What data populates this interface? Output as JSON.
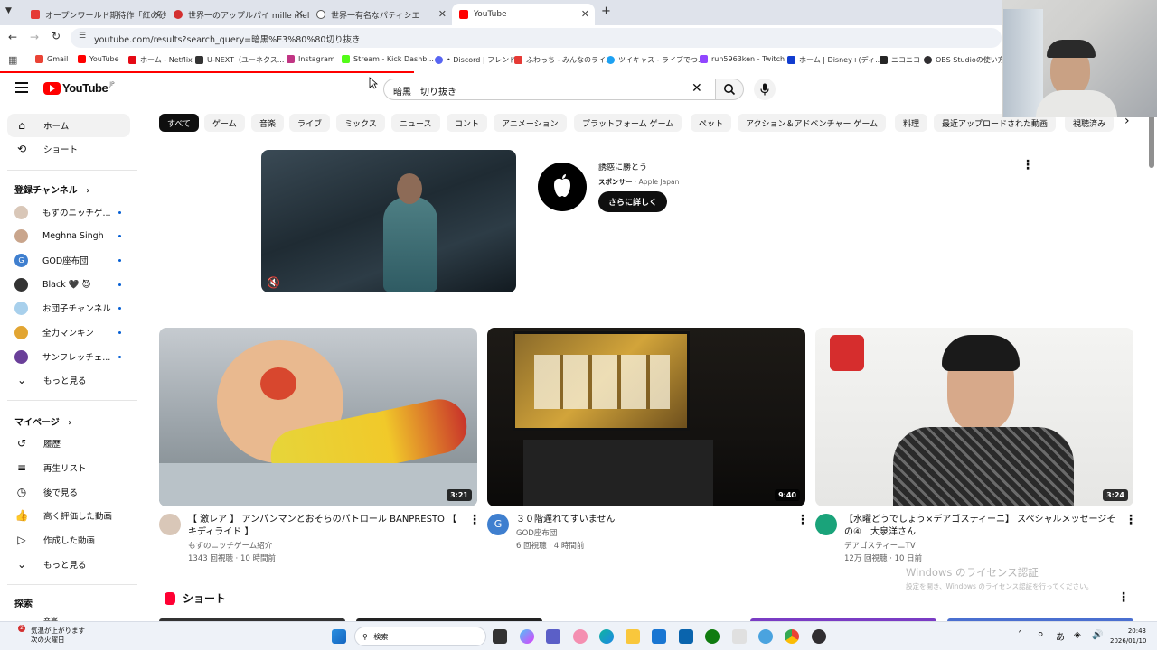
{
  "browser": {
    "tabs": [
      {
        "title": "オープンワールド期待作「紅の砂漠」",
        "color": "#e53935"
      },
      {
        "title": "世界一のアップルパイ mille mele",
        "color": "#d32f2f"
      },
      {
        "title": "世界一有名なパティシエ",
        "color": "#555555"
      },
      {
        "title": "YouTube",
        "color": "#ff0000"
      }
    ],
    "new_tab": "+",
    "url": "youtube.com/results?search_query=暗黒%E3%80%80切り抜き",
    "bookmarks": [
      {
        "label": "Gmail",
        "color": "#ea4335"
      },
      {
        "label": "YouTube",
        "color": "#ff0000"
      },
      {
        "label": "ホーム - Netflix",
        "color": "#e50914"
      },
      {
        "label": "U-NEXT（ユーネクス...",
        "color": "#333333"
      },
      {
        "label": "Instagram",
        "color": "#c13584"
      },
      {
        "label": "Stream - Kick Dashb...",
        "color": "#53fc18"
      },
      {
        "label": "• Discord | フレンド",
        "color": "#5865f2"
      },
      {
        "label": "ふわっち - みんなのライ...",
        "color": "#e53935"
      },
      {
        "label": "ツイキャス - ライブでつ...",
        "color": "#1da1f2"
      },
      {
        "label": "run5963ken - Twitch",
        "color": "#9146ff"
      },
      {
        "label": "ホーム | Disney+(ディ...",
        "color": "#113ccf"
      },
      {
        "label": "ニコニコ",
        "color": "#252525"
      },
      {
        "label": "OBS Studioの使い方...",
        "color": "#302e31"
      }
    ]
  },
  "youtube": {
    "logo": "YouTube",
    "region": "JP",
    "search_value": "暗黒　切り抜き",
    "sidebar": {
      "main": [
        {
          "label": "ホーム",
          "icon": "home-icon"
        },
        {
          "label": "ショート",
          "icon": "shorts-icon"
        }
      ],
      "subscriptions_title": "登録チャンネル",
      "subscriptions": [
        {
          "label": "もずのニッチゲ...",
          "color": "#d9c7b8"
        },
        {
          "label": "Meghna Singh",
          "color": "#c9a58c"
        },
        {
          "label": "GOD座布団",
          "color": "#3f7fcf",
          "letter": "G"
        },
        {
          "label": "Black 🖤 😈",
          "color": "#333333"
        },
        {
          "label": "お団子チャンネル",
          "color": "#a8d0ec"
        },
        {
          "label": "全力マンキン",
          "color": "#e2a532"
        },
        {
          "label": "サンフレッチェ...",
          "color": "#6a3f99"
        }
      ],
      "more_subs": "もっと見る",
      "you_title": "マイページ",
      "you_items": [
        {
          "label": "履歴",
          "icon": "history-icon"
        },
        {
          "label": "再生リスト",
          "icon": "playlist-icon"
        },
        {
          "label": "後で見る",
          "icon": "clock-icon"
        },
        {
          "label": "高く評価した動画",
          "icon": "thumbs-up-icon"
        },
        {
          "label": "作成した動画",
          "icon": "video-icon"
        },
        {
          "label": "もっと見る",
          "icon": "chevron-down-icon"
        }
      ],
      "explore_title": "探索",
      "explore_partial": "音楽"
    },
    "chips": [
      "すべて",
      "ゲーム",
      "音楽",
      "ライブ",
      "ミックス",
      "ニュース",
      "コント",
      "アニメーション",
      "プラットフォーム ゲーム",
      "ペット",
      "アクション＆アドベンチャー ゲーム",
      "料理",
      "最近アップロードされた動画",
      "視聴済み"
    ],
    "ad": {
      "title": "誘惑に勝とう",
      "sponsor_label": "スポンサー",
      "advertiser": "Apple Japan",
      "cta": "さらに詳しく"
    },
    "videos": [
      {
        "title": "【 激レア 】 アンパンマンとおそらのパトロール BANPRESTO 【 キディライド 】",
        "channel": "もずのニッチゲーム紹介",
        "meta": "1343 回視聴 · 10 時間前",
        "duration": "3:21",
        "avatar_color": "#d9c7b8"
      },
      {
        "title": "３０階遅れてすいません",
        "channel": "GOD座布団",
        "meta": "6 回視聴 · 4 時間前",
        "duration": "9:40",
        "avatar_color": "#3f7fcf",
        "letter": "G"
      },
      {
        "title": "【水曜どうでしょう×デアゴスティーニ】 スペシャルメッセージその④　大泉洋さん",
        "channel": "デアゴスティーニTV",
        "meta": "12万 回視聴 · 10 日前",
        "duration": "3:24",
        "avatar_color": "#1aa37a"
      }
    ],
    "shorts_title": "ショート"
  },
  "watermark": {
    "line1": "Windows のライセンス認証",
    "line2": "設定を開き、Windows のライセンス認証を行ってください。"
  },
  "taskbar": {
    "weather_line1": "気温が上がります",
    "weather_line2": "次の火曜日",
    "weather_badge": "2",
    "search_placeholder": "検索",
    "ime": "あ",
    "time": "20:43",
    "date": "2026/01/10"
  }
}
